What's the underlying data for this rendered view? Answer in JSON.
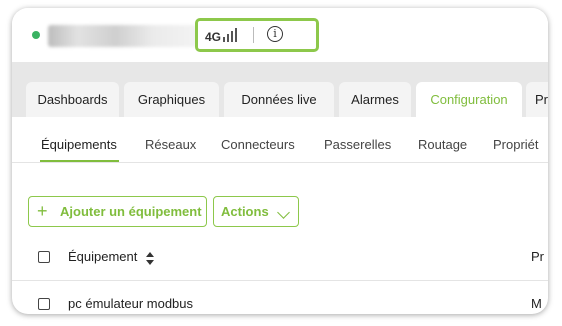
{
  "topbar": {
    "network_label": "4G",
    "signal_icon": "signal-bars-icon",
    "info_icon": "info-icon",
    "info_glyph": "i",
    "accent": "#8dc84b",
    "status_color": "#3ab262"
  },
  "tabs": [
    {
      "label": "Dashboards"
    },
    {
      "label": "Graphiques"
    },
    {
      "label": "Données live"
    },
    {
      "label": "Alarmes"
    },
    {
      "label": "Configuration",
      "active": true
    },
    {
      "label": "Pro"
    }
  ],
  "subtabs": [
    {
      "label": "Équipements",
      "active": true
    },
    {
      "label": "Réseaux"
    },
    {
      "label": "Connecteurs"
    },
    {
      "label": "Passerelles"
    },
    {
      "label": "Routage"
    },
    {
      "label": "Propriét"
    }
  ],
  "actions": {
    "add_label": "Ajouter un équipement",
    "add_glyph": "+",
    "actions_label": "Actions"
  },
  "table": {
    "headers": [
      "Équipement",
      "Pr"
    ],
    "rows": [
      {
        "name": "pc émulateur modbus",
        "col2": "M"
      }
    ]
  }
}
